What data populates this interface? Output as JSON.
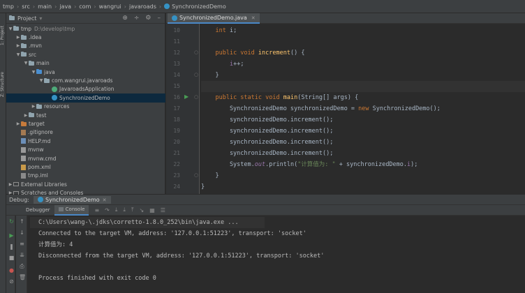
{
  "breadcrumb": [
    "tmp",
    "src",
    "main",
    "java",
    "com",
    "wangrui",
    "javaroads",
    "SynchronizedDemo"
  ],
  "left_strip": {
    "project_tab": "1: Project",
    "structure_tab": "Z: Structure"
  },
  "project_panel": {
    "title": "Project",
    "tree": [
      {
        "label": "tmp",
        "extra": "D:\\develop\\tmp",
        "kind": "folder",
        "depth": 0,
        "open": true
      },
      {
        "label": ".idea",
        "kind": "folder",
        "depth": 1,
        "open": false
      },
      {
        "label": ".mvn",
        "kind": "folder",
        "depth": 1,
        "open": false
      },
      {
        "label": "src",
        "kind": "folder",
        "depth": 1,
        "open": true
      },
      {
        "label": "main",
        "kind": "folder",
        "depth": 2,
        "open": true
      },
      {
        "label": "java",
        "kind": "folder-blue",
        "depth": 3,
        "open": true
      },
      {
        "label": "com.wangrui.javaroads",
        "kind": "folder",
        "depth": 4,
        "open": true
      },
      {
        "label": "JavaroadsApplication",
        "kind": "class-green",
        "depth": 5
      },
      {
        "label": "SynchronizedDemo",
        "kind": "class",
        "depth": 5,
        "selected": true
      },
      {
        "label": "resources",
        "kind": "folder",
        "depth": 3,
        "open": false
      },
      {
        "label": "test",
        "kind": "folder",
        "depth": 2,
        "open": false
      },
      {
        "label": "target",
        "kind": "folder-orange",
        "depth": 1,
        "open": false
      },
      {
        "label": ".gitignore",
        "kind": "file-git",
        "depth": 1
      },
      {
        "label": "HELP.md",
        "kind": "file-md",
        "depth": 1
      },
      {
        "label": "mvnw",
        "kind": "file",
        "depth": 1
      },
      {
        "label": "mvnw.cmd",
        "kind": "file",
        "depth": 1
      },
      {
        "label": "pom.xml",
        "kind": "file-xml",
        "depth": 1
      },
      {
        "label": "tmp.iml",
        "kind": "file-iml",
        "depth": 1
      },
      {
        "label": "External Libraries",
        "kind": "ext",
        "depth": 0,
        "open": false
      },
      {
        "label": "Scratches and Consoles",
        "kind": "ext",
        "depth": 0,
        "open": false
      }
    ]
  },
  "editor": {
    "tab_label": "SynchronizedDemo.java",
    "lines": [
      {
        "n": "10",
        "tokens": [
          [
            "    ",
            ""
          ],
          [
            "int ",
            "kw"
          ],
          [
            "i;",
            ""
          ]
        ]
      },
      {
        "n": "11",
        "tokens": []
      },
      {
        "n": "12",
        "tokens": [
          [
            "    ",
            ""
          ],
          [
            "public void ",
            "kw"
          ],
          [
            "increment",
            "fn"
          ],
          [
            "() {",
            ""
          ]
        ]
      },
      {
        "n": "13",
        "tokens": [
          [
            "        ",
            ""
          ],
          [
            "i",
            "fld2"
          ],
          [
            "++;",
            ""
          ]
        ]
      },
      {
        "n": "14",
        "tokens": [
          [
            "    }",
            ""
          ]
        ]
      },
      {
        "n": "15",
        "tokens": [],
        "current": true
      },
      {
        "n": "16",
        "tokens": [
          [
            "    ",
            ""
          ],
          [
            "public static void ",
            "kw"
          ],
          [
            "main",
            "fn"
          ],
          [
            "(String[] args) {",
            ""
          ]
        ]
      },
      {
        "n": "17",
        "tokens": [
          [
            "        SynchronizedDemo synchronizedDemo = ",
            ""
          ],
          [
            "new ",
            "kw"
          ],
          [
            "SynchronizedDemo();",
            ""
          ]
        ]
      },
      {
        "n": "18",
        "tokens": [
          [
            "        synchronizedDemo.increment();",
            ""
          ]
        ]
      },
      {
        "n": "19",
        "tokens": [
          [
            "        synchronizedDemo.increment();",
            ""
          ]
        ]
      },
      {
        "n": "20",
        "tokens": [
          [
            "        synchronizedDemo.increment();",
            ""
          ]
        ]
      },
      {
        "n": "21",
        "tokens": [
          [
            "        synchronizedDemo.increment();",
            ""
          ]
        ]
      },
      {
        "n": "22",
        "tokens": [
          [
            "        System.",
            ""
          ],
          [
            "out",
            "fld"
          ],
          [
            ".println(",
            ""
          ],
          [
            "\"计算值为: \"",
            "str"
          ],
          [
            " + synchronizedDemo.",
            ""
          ],
          [
            "i",
            "fld2"
          ],
          [
            ");",
            ""
          ]
        ]
      },
      {
        "n": "23",
        "tokens": [
          [
            "    }",
            ""
          ]
        ]
      },
      {
        "n": "24",
        "tokens": [
          [
            "}",
            ""
          ]
        ]
      }
    ]
  },
  "debug": {
    "label": "Debug:",
    "session": "SynchronizedDemo",
    "tabs": [
      "Debugger",
      "Console"
    ],
    "console_lines": [
      "C:\\Users\\wang-\\.jdks\\corretto-1.8.0_252\\bin\\java.exe ...",
      "Connected to the target VM, address: '127.0.0.1:51223', transport: 'socket'",
      "计算值为: 4",
      "Disconnected from the target VM, address: '127.0.0.1:51223', transport: 'socket'",
      "",
      "Process finished with exit code 0"
    ]
  }
}
